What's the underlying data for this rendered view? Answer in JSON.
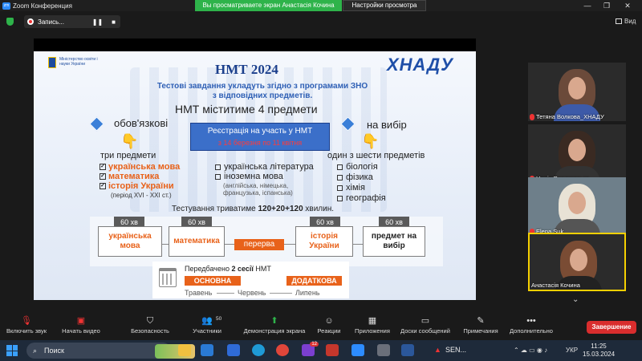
{
  "window": {
    "app_title": "Zoom Конференция",
    "share_banner": "Вы просматриваете экран Анастасія Кочина",
    "view_settings": "Настройки просмотра",
    "minimize": "—",
    "restore": "❐",
    "close": "✕"
  },
  "recording": {
    "label": "Запись...",
    "pause": "❚❚",
    "stop": "■"
  },
  "view_button": {
    "label": "Вид"
  },
  "slide": {
    "ministry_text": "Міністерство освіти і науки України",
    "title": "НМТ 2024",
    "university": "ХНАДУ",
    "subtitle": "Тестові завдання укладуть згідно з програмами ЗНО з відповідних предметів.",
    "subjects_count": "НМТ міститиме 4 предмети",
    "required_label": "обов'язкові",
    "choice_label": "на вибір",
    "registration_title": "Реєстрація на участь у НМТ",
    "registration_dates": "з 14 березня по 11 квітня",
    "three_subjects": "три предмети",
    "one_of_six": "один з шести предметів",
    "required_subjects": [
      "українська мова",
      "математика",
      "історія України"
    ],
    "history_period": "(період XVI - XXI ст.)",
    "optional_subjects_1": [
      "українська література",
      "іноземна мова"
    ],
    "language_note": "(англійська, німецька, французька, іспанська)",
    "optional_subjects_2": [
      "біологія",
      "фізика",
      "хімія",
      "географія"
    ],
    "duration_prefix": "Тестування триватиме ",
    "duration_value": "120+20+120",
    "duration_suffix": " хвилин.",
    "schedule": [
      {
        "mins": "60 хв",
        "subject": "українська мова"
      },
      {
        "mins": "60 хв",
        "subject": "математика"
      },
      {
        "pause": "перерва"
      },
      {
        "mins": "60 хв",
        "subject": "історія України"
      },
      {
        "mins": "60 хв",
        "subject": "предмет на вибір"
      }
    ],
    "sessions_title_prefix": "Передбачено ",
    "sessions_title_bold": "2 сесії",
    "sessions_title_suffix": " НМТ",
    "session_main": "ОСНОВНА",
    "session_extra": "ДОДАТКОВА",
    "months": [
      "Травень",
      "Червень",
      "Липень"
    ]
  },
  "participants": [
    {
      "name": "Тетяна Волкова_ХНАДУ",
      "muted": true
    },
    {
      "name": "Надія Разумовська",
      "muted": true
    },
    {
      "name": "Elena Suk",
      "muted": true
    },
    {
      "name": "Анастасія Кочина",
      "muted": false
    }
  ],
  "scroll_down": "⌄",
  "toolbar": {
    "mute": "Включить звук",
    "video": "Начать видео",
    "security": "Безопасность",
    "participants": "Участники",
    "participants_count": "50",
    "share": "Демонстрация экрана",
    "reactions": "Реакции",
    "apps": "Приложения",
    "whiteboard": "Доски сообщений",
    "notes": "Примечания",
    "more": "Дополнительно",
    "end": "Завершение"
  },
  "taskbar": {
    "search": "Поиск",
    "sen": "SEN...",
    "lang": "УКР",
    "time": "11:25",
    "date": "15.03.2024",
    "mail_badge": "12"
  },
  "colors": {
    "accent_orange": "#e8621a",
    "zoom_green": "#2eb34a",
    "end_red": "#d92d2d",
    "slide_blue": "#1b3f8c"
  }
}
